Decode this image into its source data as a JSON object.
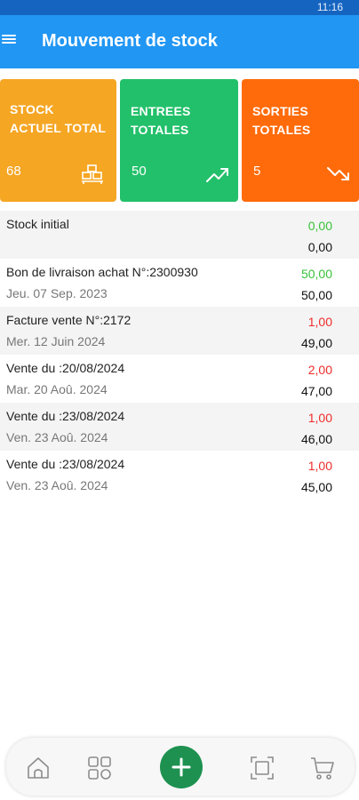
{
  "status_bar": {
    "time": "11:16"
  },
  "app_bar": {
    "title": "Mouvement de stock",
    "menu_icon": "hamburger-menu-icon"
  },
  "summary_cards": [
    {
      "label": "STOCK ACTUEL TOTAL",
      "value": "68",
      "icon": "boxes-icon",
      "color": "#f5a623"
    },
    {
      "label": "ENTREES TOTALES",
      "value": "50",
      "icon": "trending-up-icon",
      "color": "#22c06a"
    },
    {
      "label": "SORTIES TOTALES",
      "value": "5",
      "icon": "trending-down-icon",
      "color": "#ff6b0a"
    }
  ],
  "movements": [
    {
      "title": "Stock initial",
      "date": "",
      "qty": "0,00",
      "balance": "0,00",
      "direction": "in"
    },
    {
      "title": "Bon de livraison achat N°:2300930",
      "date": "Jeu. 07 Sep. 2023",
      "qty": "50,00",
      "balance": "50,00",
      "direction": "in"
    },
    {
      "title": "Facture vente N°:2172",
      "date": "Mer. 12 Juin 2024",
      "qty": "1,00",
      "balance": "49,00",
      "direction": "out"
    },
    {
      "title": "Vente du :20/08/2024",
      "date": "Mar. 20 Aoû. 2024",
      "qty": "2,00",
      "balance": "47,00",
      "direction": "out"
    },
    {
      "title": "Vente du :23/08/2024",
      "date": "Ven. 23 Aoû. 2024",
      "qty": "1,00",
      "balance": "46,00",
      "direction": "out"
    },
    {
      "title": "Vente du :23/08/2024",
      "date": "Ven. 23 Aoû. 2024",
      "qty": "1,00",
      "balance": "45,00",
      "direction": "out"
    }
  ],
  "bottom_nav": {
    "items": [
      "home-icon",
      "grid-icon",
      "add-icon",
      "scan-icon",
      "cart-icon"
    ],
    "fab_color": "#1e9150"
  }
}
